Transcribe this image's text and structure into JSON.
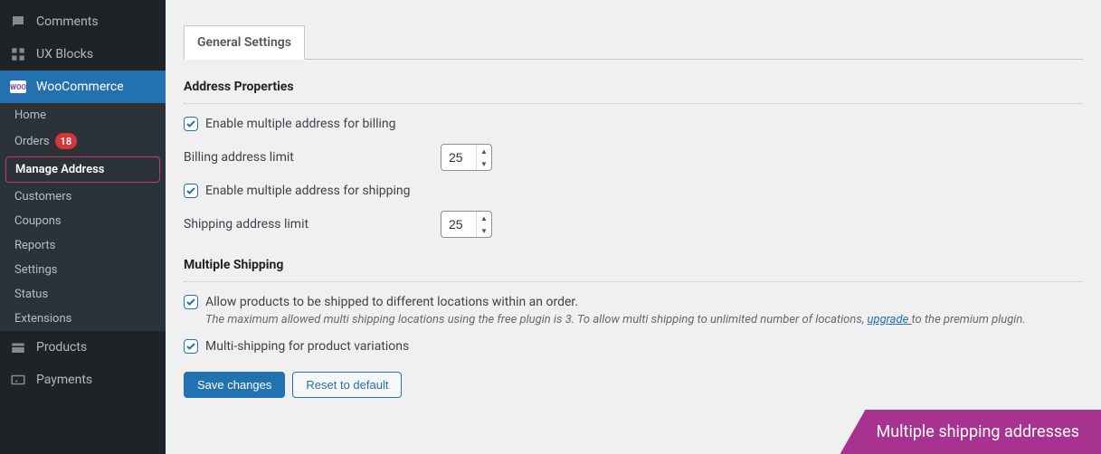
{
  "sidebar": {
    "items": [
      {
        "label": "Comments"
      },
      {
        "label": "UX Blocks"
      },
      {
        "label": "WooCommerce"
      },
      {
        "label": "Products"
      },
      {
        "label": "Payments"
      }
    ],
    "submenu": [
      {
        "label": "Home"
      },
      {
        "label": "Orders",
        "badge": "18"
      },
      {
        "label": "Manage Address"
      },
      {
        "label": "Customers"
      },
      {
        "label": "Coupons"
      },
      {
        "label": "Reports"
      },
      {
        "label": "Settings"
      },
      {
        "label": "Status"
      },
      {
        "label": "Extensions"
      }
    ]
  },
  "tabs": {
    "general": "General Settings"
  },
  "sections": {
    "address": {
      "title": "Address Properties",
      "enable_billing": "Enable multiple address for billing",
      "billing_limit_label": "Billing address limit",
      "billing_limit_value": "25",
      "enable_shipping": "Enable multiple address for shipping",
      "shipping_limit_label": "Shipping address limit",
      "shipping_limit_value": "25"
    },
    "multiship": {
      "title": "Multiple Shipping",
      "allow_multiship": "Allow products to be shipped to different locations within an order.",
      "desc_pre": "The maximum allowed multi shipping locations using the free plugin is 3. To allow multi shipping to unlimited number of locations, ",
      "desc_link": "upgrade ",
      "desc_post": "to the premium plugin.",
      "variations": "Multi-shipping for product variations"
    }
  },
  "actions": {
    "save": "Save changes",
    "reset": "Reset to default"
  },
  "promo": "Multiple shipping addresses",
  "woo_badge": "WOO"
}
